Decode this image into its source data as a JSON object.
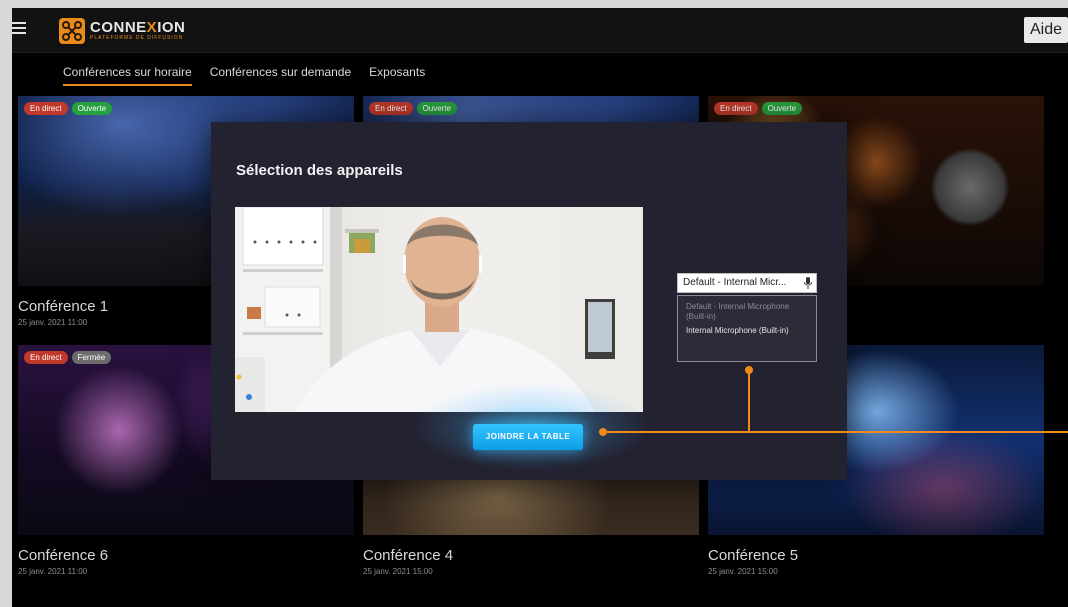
{
  "header": {
    "brand_name_pre": "CONNE",
    "brand_name_x": "X",
    "brand_name_post": "ION",
    "brand_tagline": "PLATEFORME DE DIFFUSION",
    "help_label": "Aide"
  },
  "tabs": [
    {
      "label": "Conférences sur horaire"
    },
    {
      "label": "Conférences sur demande"
    },
    {
      "label": "Exposants"
    }
  ],
  "cards": [
    {
      "title": "Conférence 1",
      "date": "25 janv. 2021 11:00",
      "badges": [
        "En direct",
        "Ouverte"
      ]
    },
    {
      "title": "",
      "date": "",
      "badges": [
        "En direct",
        "Ouverte"
      ]
    },
    {
      "title": "",
      "date": "",
      "badges": [
        "En direct",
        "Ouverte"
      ]
    },
    {
      "title": "Conférence 6",
      "date": "25 janv. 2021 11:00",
      "badges": [
        "En direct",
        "Fermée"
      ]
    },
    {
      "title": "Conférence 4",
      "date": "25 janv. 2021 15:00",
      "badges": []
    },
    {
      "title": "Conférence 5",
      "date": "25 janv. 2021 15:00",
      "badges": []
    }
  ],
  "modal": {
    "title": "Sélection des appareils",
    "mic_selected": "Default - Internal Micr...",
    "mic_options": [
      "Default - Internal Microphone (Built-in)",
      "Internal Microphone (Built-in)"
    ],
    "join_label": "JOINDRE LA TABLE"
  },
  "colors": {
    "accent": "#e98b1c",
    "join_button": "#1aafef",
    "badge_live": "#c0392b",
    "badge_open": "#27a040",
    "badge_closed": "#6c6c6c"
  },
  "icons": [
    "hamburger-icon",
    "connexion-logo-icon",
    "microphone-icon"
  ]
}
